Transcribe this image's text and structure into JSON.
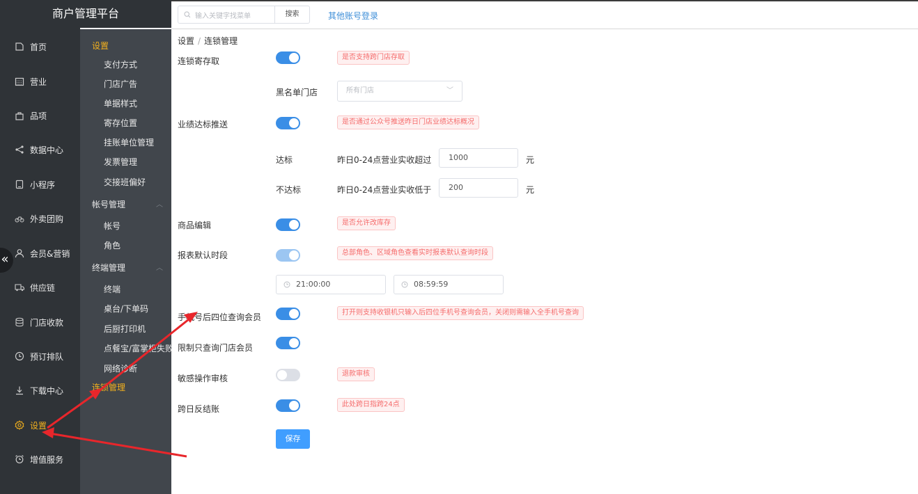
{
  "app_title": "商户管理平台",
  "topbar": {
    "search_placeholder": "输入关键字找菜单",
    "search_button": "搜索",
    "other_login": "其他账号登录"
  },
  "nav": {
    "items": [
      {
        "label": "首页",
        "icon": "home-icon"
      },
      {
        "label": "营业",
        "icon": "calendar-icon"
      },
      {
        "label": "品项",
        "icon": "bag-icon"
      },
      {
        "label": "数据中心",
        "icon": "share-icon"
      },
      {
        "label": "小程序",
        "icon": "tablet-icon"
      },
      {
        "label": "外卖团购",
        "icon": "bike-icon"
      },
      {
        "label": "会员&营销",
        "icon": "user-icon"
      },
      {
        "label": "供应链",
        "icon": "truck-icon"
      },
      {
        "label": "门店收款",
        "icon": "database-icon"
      },
      {
        "label": "预订排队",
        "icon": "clock-icon"
      },
      {
        "label": "下载中心",
        "icon": "download-icon"
      },
      {
        "label": "设置",
        "icon": "gear-icon",
        "active": true
      },
      {
        "label": "增值服务",
        "icon": "alarm-icon"
      }
    ],
    "collapse_glyph": "«"
  },
  "subnav": {
    "settings_head": "设置",
    "settings_items": [
      "支付方式",
      "门店广告",
      "单据样式",
      "寄存位置",
      "挂账单位管理",
      "发票管理",
      "交接班偏好"
    ],
    "account_head": "帐号管理",
    "account_items": [
      "帐号",
      "角色"
    ],
    "terminal_head": "终端管理",
    "terminal_items": [
      "终端",
      "桌台/下单码",
      "后厨打印机",
      "点餐宝/富掌柜失败",
      "网络诊断"
    ],
    "chain_item": "连锁管理"
  },
  "breadcrumb": {
    "root": "设置",
    "separator": "/",
    "current": "连锁管理"
  },
  "form": {
    "chain_storage": {
      "label": "连锁寄存取",
      "enabled": true,
      "tip": "是否支持跨门店存取"
    },
    "blacklist": {
      "label": "黑名单门店",
      "placeholder": "所有门店"
    },
    "performance_push": {
      "label": "业绩达标推送",
      "enabled": true,
      "tip": "是否通过公众号推送昨日门店业绩达标概况"
    },
    "reach": {
      "label": "达标",
      "desc": "昨日0-24点营业实收超过",
      "value": "1000",
      "unit": "元"
    },
    "not_reach": {
      "label": "不达标",
      "desc": "昨日0-24点营业实收低于",
      "value": "200",
      "unit": "元"
    },
    "product_edit": {
      "label": "商品编辑",
      "enabled": true,
      "tip": "是否允许改库存"
    },
    "report_period": {
      "label": "报表默认时段",
      "enabled": true,
      "tip": "总部角色、区域角色查看实时报表默认查询时段",
      "start": "21:00:00",
      "end": "08:59:59"
    },
    "phone_last4": {
      "label": "手机号后四位查询会员",
      "enabled": true,
      "tip": "打开则支持收银机只输入后四位手机号查询会员，关闭则需输入全手机号查询"
    },
    "store_member_only": {
      "label": "限制只查询门店会员",
      "enabled": true
    },
    "sensitive_audit": {
      "label": "敏感操作审核",
      "enabled": false,
      "tip": "退款审核"
    },
    "cross_day": {
      "label": "跨日反结账",
      "enabled": true,
      "tip": "此处跨日指跨24点"
    },
    "save_label": "保存"
  },
  "colors": {
    "accent": "#409eff",
    "nav_bg": "#2f3337",
    "subnav_bg": "#41464c",
    "active": "#f2b01e",
    "annotation_arrow": "#e8262b"
  }
}
